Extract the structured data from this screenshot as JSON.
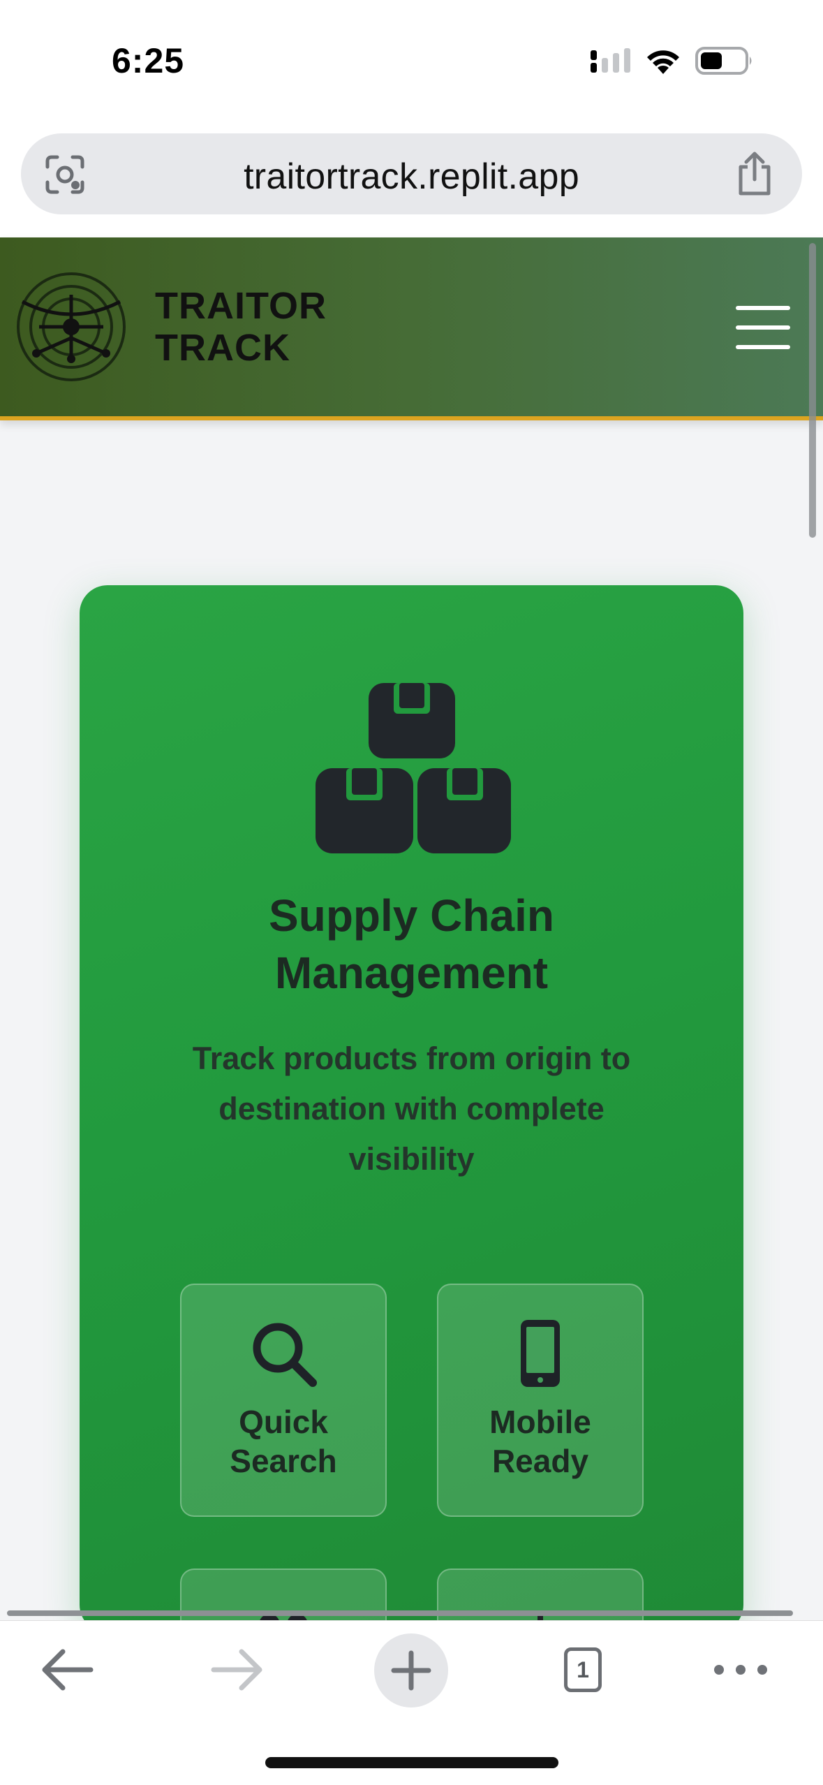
{
  "status_bar": {
    "time": "6:25"
  },
  "browser": {
    "url": "traitortrack.replit.app",
    "tab_count": "1"
  },
  "header": {
    "brand_line1": "TRAITOR",
    "brand_line2": "TRACK",
    "colors": {
      "gradient_start": "#3d5a1f",
      "gradient_end": "#4c7a56",
      "accent_border": "#dca420"
    }
  },
  "hero": {
    "icon": "boxes-icon",
    "title_line1": "Supply Chain",
    "title_line2": "Management",
    "subtitle": "Track products from origin to destination with complete visibility",
    "colors": {
      "card": "#229a3e",
      "text": "#1c2a22"
    },
    "features": [
      {
        "icon": "search-icon",
        "label_line1": "Quick",
        "label_line2": "Search"
      },
      {
        "icon": "mobile-icon",
        "label_line1": "Mobile",
        "label_line2": "Ready"
      }
    ]
  }
}
